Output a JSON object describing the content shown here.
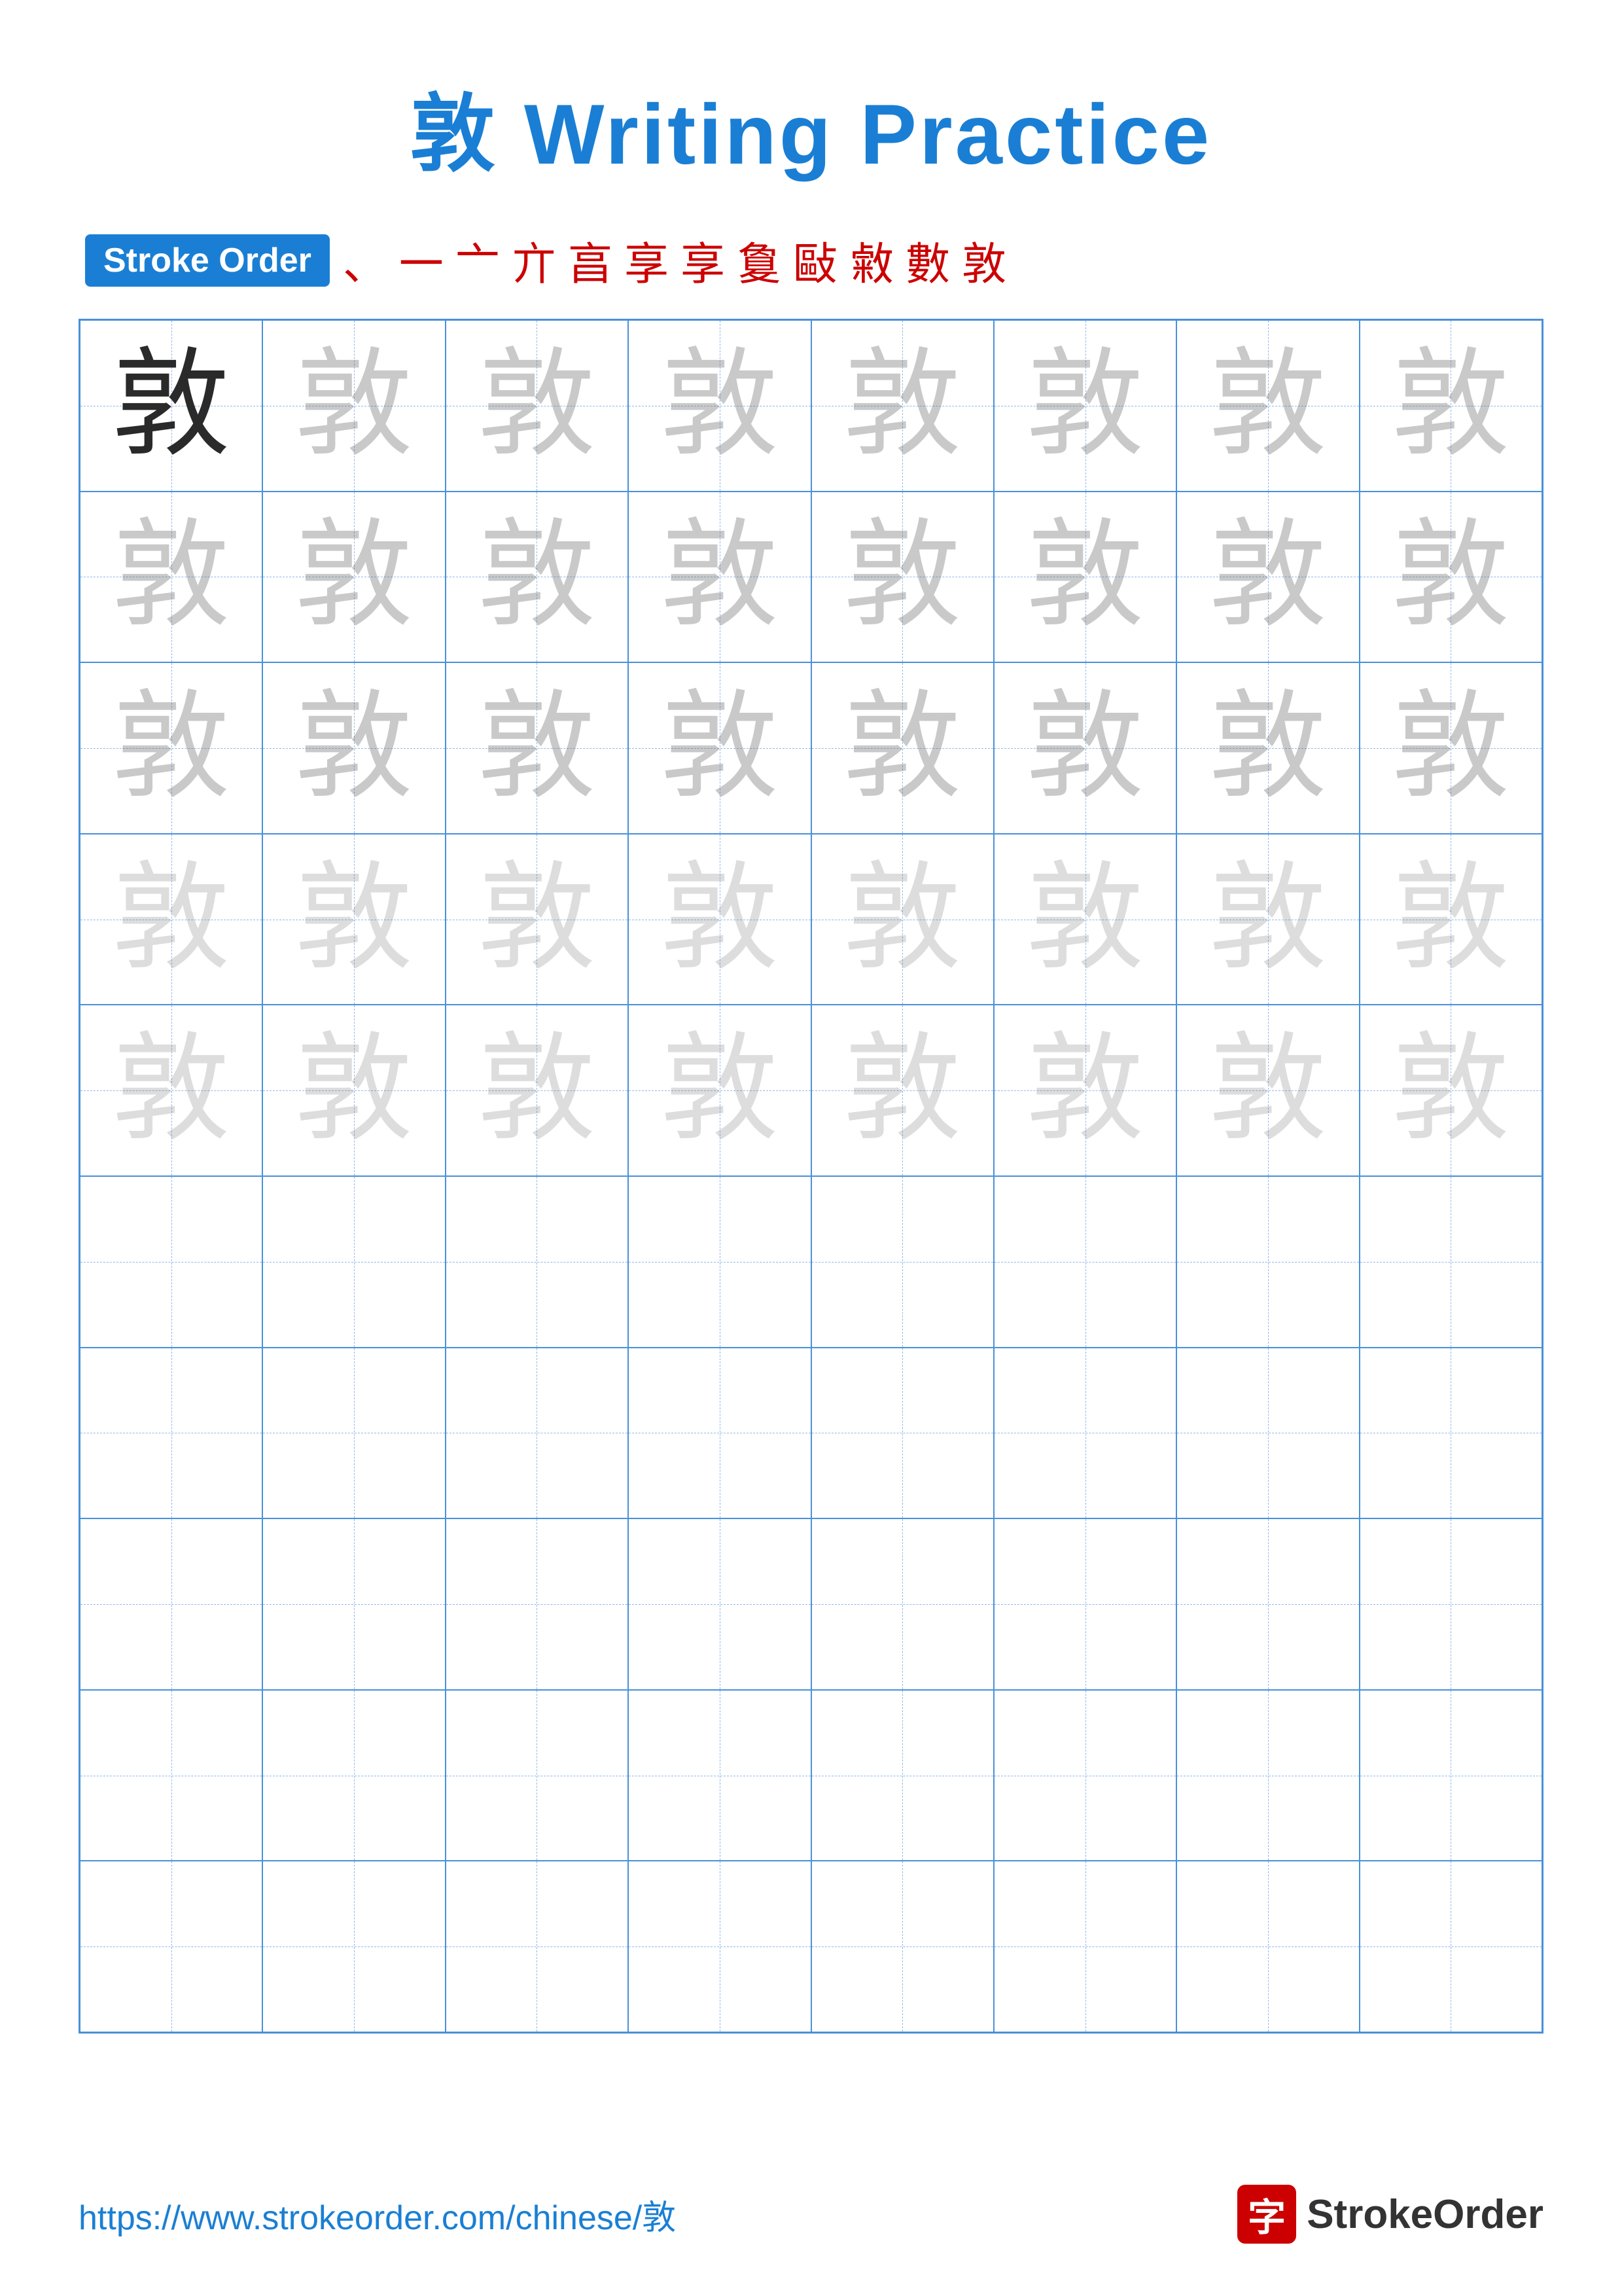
{
  "title": "敦 Writing Practice",
  "stroke_order": {
    "badge_label": "Stroke Order",
    "strokes": [
      "、",
      "一",
      "亠",
      "亣",
      "亯",
      "享",
      "享",
      "敻",
      "敺",
      "敹",
      "數",
      "敦"
    ]
  },
  "character": "敦",
  "grid": {
    "cols": 8,
    "rows": 10,
    "filled_rows": 5,
    "empty_rows": 5
  },
  "footer": {
    "url": "https://www.strokeorder.com/chinese/敦",
    "logo_char": "字",
    "logo_name": "StrokeOrder"
  }
}
